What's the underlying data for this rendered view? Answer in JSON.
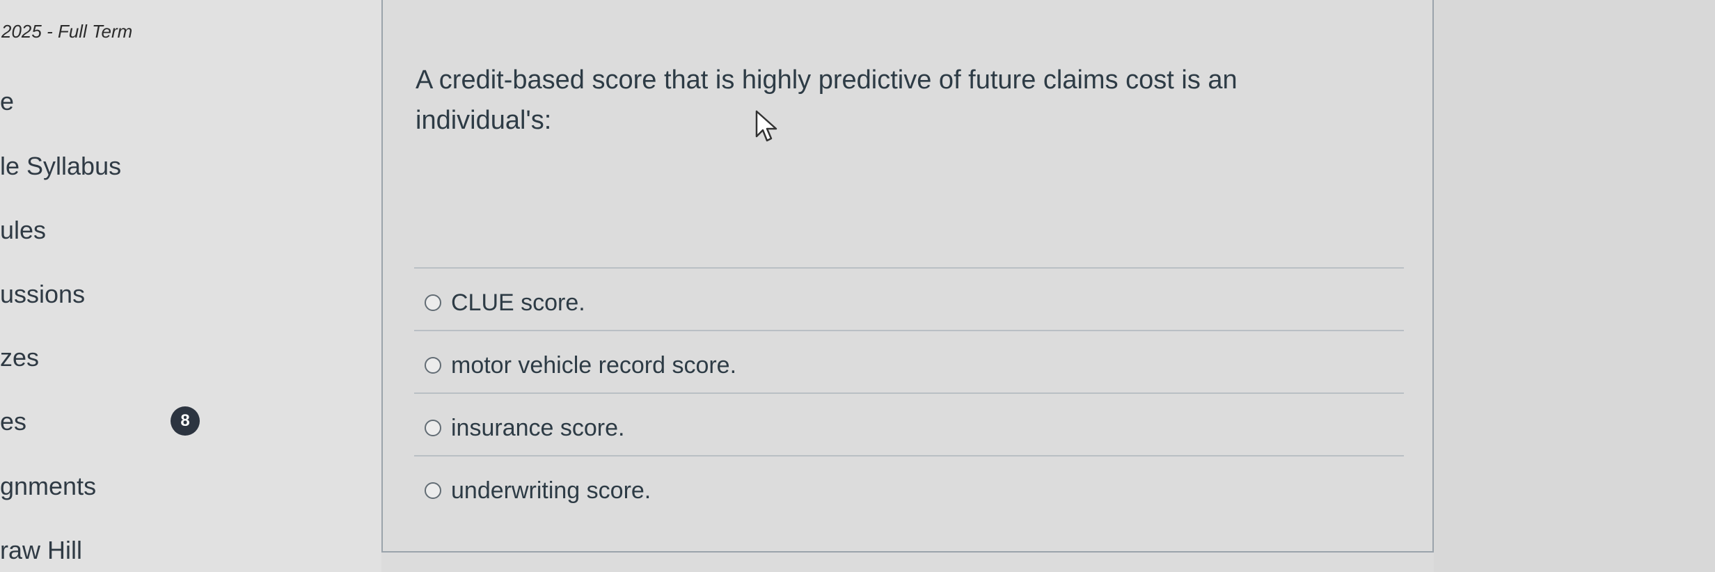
{
  "sidebar": {
    "term": "2025 - Full Term",
    "items": [
      {
        "label": "e"
      },
      {
        "label": "le Syllabus"
      },
      {
        "label": "ules"
      },
      {
        "label": "ussions"
      },
      {
        "label": "zes"
      },
      {
        "label": "es",
        "badge": "8"
      },
      {
        "label": "gnments"
      },
      {
        "label": "raw Hill"
      }
    ]
  },
  "question": {
    "text": "A credit-based score that is highly predictive of future claims cost is an individual's:",
    "answers": [
      {
        "label": "CLUE score."
      },
      {
        "label": "motor vehicle record score."
      },
      {
        "label": "insurance score."
      },
      {
        "label": "underwriting score."
      }
    ]
  }
}
